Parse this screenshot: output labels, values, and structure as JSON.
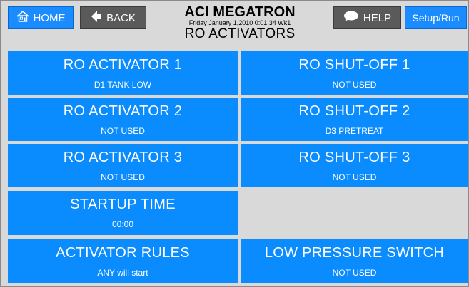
{
  "header": {
    "title": "ACI MEGATRON",
    "datetime": "Friday January 1,2010 0:01:34 Wk1",
    "subtitle": "RO ACTIVATORS"
  },
  "nav": {
    "home_label": "HOME",
    "back_label": "BACK",
    "help_label": "HELP",
    "setup_label": "Setup/Run"
  },
  "tiles": {
    "ro_activator_1": {
      "title": "RO ACTIVATOR 1",
      "value": "D1 TANK LOW"
    },
    "ro_activator_2": {
      "title": "RO ACTIVATOR 2",
      "value": "NOT USED"
    },
    "ro_activator_3": {
      "title": "RO ACTIVATOR 3",
      "value": "NOT USED"
    },
    "startup_time": {
      "title": "STARTUP TIME",
      "value": "00:00"
    },
    "activator_rules": {
      "title": "ACTIVATOR RULES",
      "value": "ANY will start"
    },
    "ro_shutoff_1": {
      "title": "RO SHUT-OFF 1",
      "value": "NOT USED"
    },
    "ro_shutoff_2": {
      "title": "RO SHUT-OFF 2",
      "value": "D3 PRETREAT"
    },
    "ro_shutoff_3": {
      "title": "RO SHUT-OFF 3",
      "value": "NOT USED"
    },
    "low_pressure_switch": {
      "title": "LOW PRESSURE SWITCH",
      "value": "NOT USED"
    }
  },
  "colors": {
    "tile_blue": "#0a8cff",
    "button_gray": "#5a5a5a",
    "background": "#d9d9d9"
  },
  "icons": {
    "home": "home-icon",
    "back": "arrow-left-icon",
    "help": "speech-bubble-icon"
  }
}
